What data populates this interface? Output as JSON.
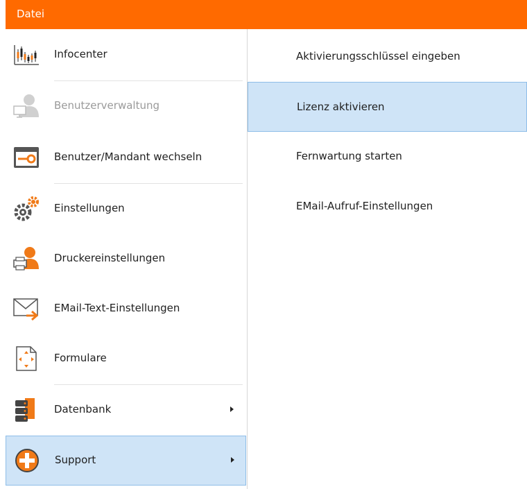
{
  "header": {
    "tab_label": "Datei",
    "accent_color": "#ff6a00"
  },
  "menu": {
    "items": [
      {
        "label": "Infocenter",
        "icon": "chart-candlestick-icon",
        "enabled": true
      },
      {
        "label": "Benutzerverwaltung",
        "icon": "user-management-icon",
        "enabled": false
      },
      {
        "label": "Benutzer/Mandant wechseln",
        "icon": "key-switch-icon",
        "enabled": true
      },
      {
        "label": "Einstellungen",
        "icon": "gears-icon",
        "enabled": true
      },
      {
        "label": "Druckereinstellungen",
        "icon": "printer-user-icon",
        "enabled": true
      },
      {
        "label": "EMail-Text-Einstellungen",
        "icon": "mail-arrow-icon",
        "enabled": true
      },
      {
        "label": "Formulare",
        "icon": "form-document-icon",
        "enabled": true
      },
      {
        "label": "Datenbank",
        "icon": "database-icon",
        "enabled": true,
        "has_submenu": true
      },
      {
        "label": "Support",
        "icon": "support-plus-icon",
        "enabled": true,
        "has_submenu": true,
        "selected": true
      }
    ]
  },
  "submenu": {
    "items": [
      {
        "label": "Aktivierungsschlüssel eingeben"
      },
      {
        "label": "Lizenz aktivieren",
        "selected": true
      },
      {
        "label": "Fernwartung starten"
      },
      {
        "label": "EMail-Aufruf-Einstellungen"
      }
    ]
  }
}
